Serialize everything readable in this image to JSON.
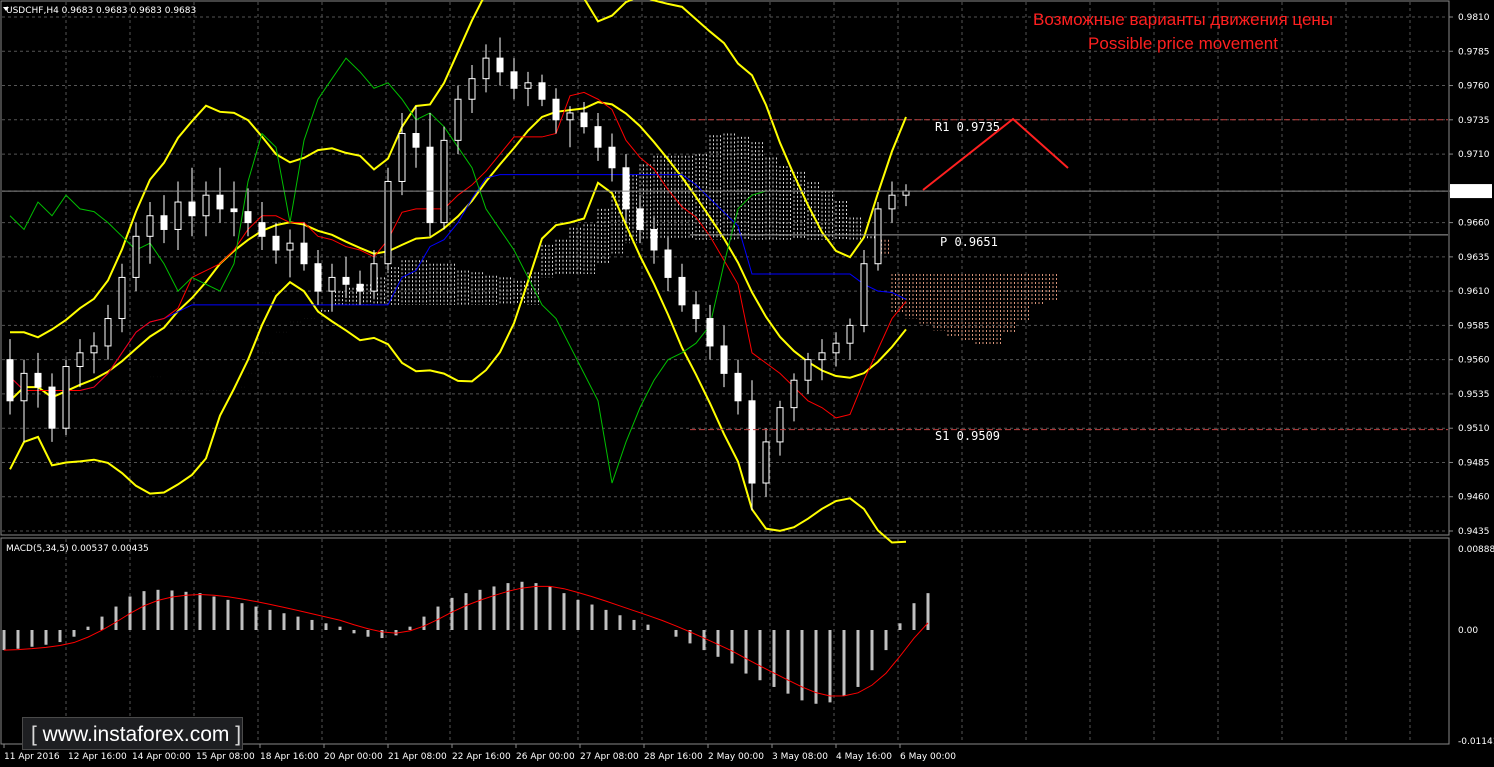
{
  "symbol_header": "USDCHF,H4  0.9683 0.9683 0.9683 0.9683",
  "annotation_ru": "Возможные варианты движения цены",
  "annotation_en": "Possible price movement",
  "levels": {
    "r1": {
      "label": "R1  0.9735",
      "value": 0.9735
    },
    "p": {
      "label": "P  0.9651",
      "value": 0.9651
    },
    "s1": {
      "label": "S1  0.9509",
      "value": 0.9509
    }
  },
  "current_price_label": "0.9683",
  "macd_header": "MACD(5,34,5) 0.00537 0.00435",
  "price_axis_ticks": [
    "0.9810",
    "0.9785",
    "0.9760",
    "0.9735",
    "0.9710",
    "0.9683",
    "0.9660",
    "0.9635",
    "0.9610",
    "0.9585",
    "0.9560",
    "0.9535",
    "0.9510",
    "0.9485",
    "0.9460",
    "0.9435"
  ],
  "macd_axis_ticks": [
    "0.00888",
    "0.00",
    "-0.01141"
  ],
  "time_axis_ticks": [
    "11 Apr 2016",
    "12 Apr 16:00",
    "14 Apr 00:00",
    "15 Apr 08:00",
    "18 Apr 16:00",
    "20 Apr 00:00",
    "21 Apr 08:00",
    "22 Apr 16:00",
    "26 Apr 00:00",
    "27 Apr 08:00",
    "28 Apr 16:00",
    "2 May 00:00",
    "3 May 08:00",
    "4 May 16:00",
    "6 May 00:00"
  ],
  "watermark": "www.instaforex.com",
  "colors": {
    "bull_candle": "#ffffff",
    "bear_candle": "#ffffff",
    "bollinger": "#ffff00",
    "tenkan": "#ff0000",
    "kijun": "#0000ff",
    "chikou": "#00c000",
    "kumo_a": "#ffffff",
    "kumo_b": "#ffb090",
    "macd_hist": "#c0c0c0",
    "macd_signal": "#ff0000",
    "annotation": "#ff2020"
  },
  "chart_data": {
    "type": "candlestick",
    "instrument": "USDCHF",
    "timeframe": "H4",
    "ylim": [
      0.9425,
      0.982
    ],
    "candles": [
      [
        0.956,
        0.9575,
        0.952,
        0.953
      ],
      [
        0.953,
        0.956,
        0.95,
        0.955
      ],
      [
        0.955,
        0.9565,
        0.9525,
        0.954
      ],
      [
        0.954,
        0.955,
        0.95,
        0.951
      ],
      [
        0.951,
        0.956,
        0.9505,
        0.9555
      ],
      [
        0.9555,
        0.9575,
        0.954,
        0.9565
      ],
      [
        0.9565,
        0.958,
        0.955,
        0.957
      ],
      [
        0.957,
        0.96,
        0.956,
        0.959
      ],
      [
        0.959,
        0.963,
        0.958,
        0.962
      ],
      [
        0.962,
        0.966,
        0.961,
        0.965
      ],
      [
        0.965,
        0.9675,
        0.963,
        0.9665
      ],
      [
        0.9665,
        0.968,
        0.9645,
        0.9655
      ],
      [
        0.9655,
        0.969,
        0.964,
        0.9675
      ],
      [
        0.9675,
        0.97,
        0.965,
        0.9665
      ],
      [
        0.9665,
        0.969,
        0.965,
        0.968
      ],
      [
        0.968,
        0.97,
        0.966,
        0.967
      ],
      [
        0.967,
        0.969,
        0.965,
        0.9668
      ],
      [
        0.9668,
        0.9685,
        0.965,
        0.966
      ],
      [
        0.966,
        0.9675,
        0.964,
        0.965
      ],
      [
        0.965,
        0.966,
        0.963,
        0.964
      ],
      [
        0.964,
        0.9655,
        0.962,
        0.9645
      ],
      [
        0.9645,
        0.966,
        0.9625,
        0.963
      ],
      [
        0.963,
        0.964,
        0.96,
        0.961
      ],
      [
        0.961,
        0.963,
        0.9595,
        0.962
      ],
      [
        0.962,
        0.9635,
        0.9605,
        0.9615
      ],
      [
        0.9615,
        0.9625,
        0.96,
        0.961
      ],
      [
        0.961,
        0.964,
        0.9605,
        0.963
      ],
      [
        0.963,
        0.97,
        0.9625,
        0.969
      ],
      [
        0.969,
        0.974,
        0.968,
        0.9725
      ],
      [
        0.9725,
        0.9745,
        0.97,
        0.9715
      ],
      [
        0.9715,
        0.974,
        0.965,
        0.966
      ],
      [
        0.966,
        0.973,
        0.9655,
        0.972
      ],
      [
        0.972,
        0.976,
        0.971,
        0.975
      ],
      [
        0.975,
        0.9775,
        0.974,
        0.9765
      ],
      [
        0.9765,
        0.979,
        0.9755,
        0.978
      ],
      [
        0.978,
        0.9795,
        0.976,
        0.977
      ],
      [
        0.977,
        0.978,
        0.975,
        0.9758
      ],
      [
        0.9758,
        0.977,
        0.9745,
        0.9762
      ],
      [
        0.9762,
        0.9768,
        0.9745,
        0.975
      ],
      [
        0.975,
        0.9758,
        0.9725,
        0.9735
      ],
      [
        0.9735,
        0.9745,
        0.9715,
        0.974
      ],
      [
        0.974,
        0.9748,
        0.9725,
        0.973
      ],
      [
        0.973,
        0.974,
        0.9705,
        0.9715
      ],
      [
        0.9715,
        0.9725,
        0.969,
        0.97
      ],
      [
        0.97,
        0.971,
        0.966,
        0.967
      ],
      [
        0.967,
        0.968,
        0.9645,
        0.9655
      ],
      [
        0.9655,
        0.9665,
        0.963,
        0.964
      ],
      [
        0.964,
        0.965,
        0.961,
        0.962
      ],
      [
        0.962,
        0.963,
        0.9595,
        0.96
      ],
      [
        0.96,
        0.961,
        0.958,
        0.959
      ],
      [
        0.959,
        0.96,
        0.956,
        0.957
      ],
      [
        0.957,
        0.9585,
        0.954,
        0.955
      ],
      [
        0.955,
        0.956,
        0.952,
        0.953
      ],
      [
        0.953,
        0.9545,
        0.945,
        0.947
      ],
      [
        0.947,
        0.951,
        0.946,
        0.95
      ],
      [
        0.95,
        0.953,
        0.949,
        0.9525
      ],
      [
        0.9525,
        0.955,
        0.9515,
        0.9545
      ],
      [
        0.9545,
        0.9565,
        0.9535,
        0.956
      ],
      [
        0.956,
        0.9575,
        0.9545,
        0.9565
      ],
      [
        0.9565,
        0.958,
        0.9555,
        0.9572
      ],
      [
        0.9572,
        0.959,
        0.956,
        0.9585
      ],
      [
        0.9585,
        0.964,
        0.958,
        0.963
      ],
      [
        0.963,
        0.9675,
        0.9625,
        0.967
      ],
      [
        0.967,
        0.969,
        0.966,
        0.968
      ],
      [
        0.968,
        0.9688,
        0.9672,
        0.9683
      ]
    ],
    "macd_histogram": [
      -0.003,
      -0.0028,
      -0.0025,
      -0.0022,
      -0.0018,
      -0.001,
      0.0005,
      0.002,
      0.0035,
      0.005,
      0.0058,
      0.006,
      0.0059,
      0.0057,
      0.0055,
      0.005,
      0.0045,
      0.004,
      0.0035,
      0.003,
      0.0025,
      0.002,
      0.0015,
      0.001,
      0.0005,
      -0.0005,
      -0.001,
      -0.0012,
      -0.0008,
      0.0005,
      0.002,
      0.0035,
      0.0048,
      0.0055,
      0.006,
      0.0065,
      0.007,
      0.0072,
      0.007,
      0.0065,
      0.0055,
      0.0045,
      0.0038,
      0.003,
      0.0022,
      0.0015,
      0.0008,
      0.0,
      -0.001,
      -0.002,
      -0.003,
      -0.004,
      -0.005,
      -0.0065,
      -0.0075,
      -0.0085,
      -0.0095,
      -0.0105,
      -0.011,
      -0.0108,
      -0.0098,
      -0.0085,
      -0.006,
      -0.003,
      0.001,
      0.004,
      0.0055
    ]
  }
}
